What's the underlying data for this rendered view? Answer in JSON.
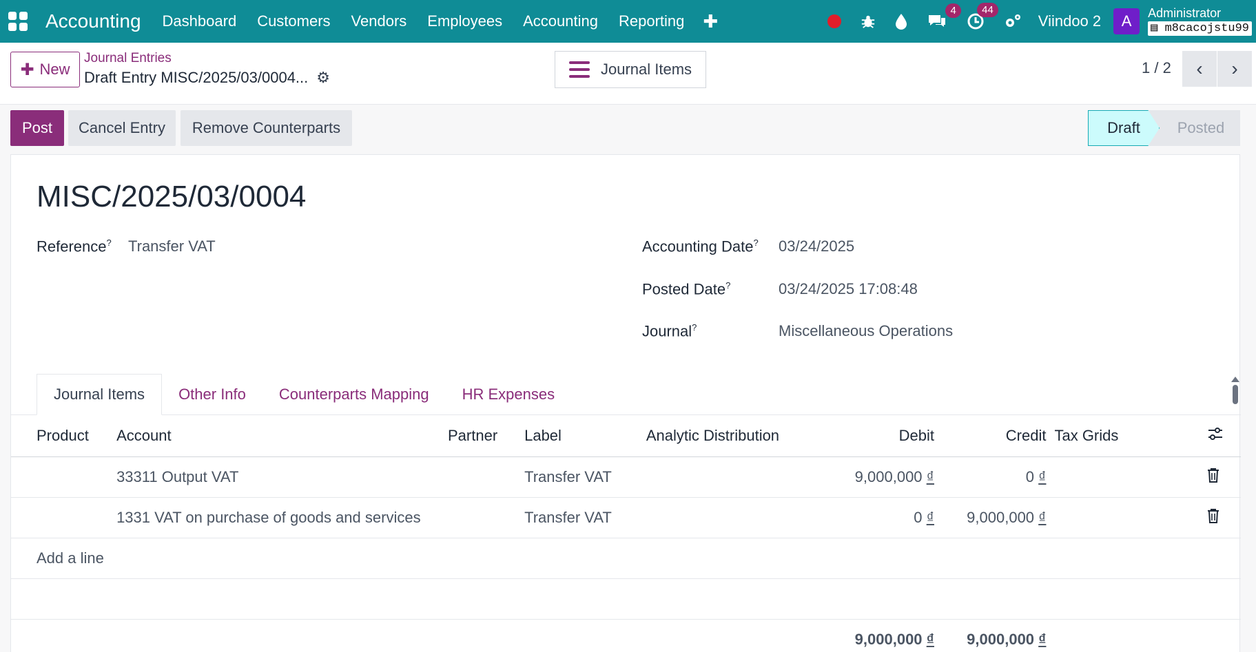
{
  "navbar": {
    "brand": "Accounting",
    "menu": [
      "Dashboard",
      "Customers",
      "Vendors",
      "Employees",
      "Accounting",
      "Reporting"
    ],
    "messages_count": "4",
    "activities_count": "44",
    "company": "Viindoo 2",
    "avatar_letter": "A",
    "user_name": "Administrator",
    "db_name": "m8cacojstu99"
  },
  "control": {
    "new_label": "New",
    "breadcrumb": "Journal Entries",
    "record_title": "Draft Entry MISC/2025/03/0004...",
    "smart_button": "Journal Items",
    "pager": "1 / 2"
  },
  "actions": {
    "post": "Post",
    "cancel": "Cancel Entry",
    "remove_counterparts": "Remove Counterparts"
  },
  "status": {
    "draft": "Draft",
    "posted": "Posted"
  },
  "form": {
    "name": "MISC/2025/03/0004",
    "reference_label": "Reference",
    "reference_value": "Transfer VAT",
    "accounting_date_label": "Accounting Date",
    "accounting_date_value": "03/24/2025",
    "posted_date_label": "Posted Date",
    "posted_date_value": "03/24/2025 17:08:48",
    "journal_label": "Journal",
    "journal_value": "Miscellaneous Operations",
    "help_mark": "?"
  },
  "tabs": [
    "Journal Items",
    "Other Info",
    "Counterparts Mapping",
    "HR Expenses"
  ],
  "lines": {
    "headers": {
      "product": "Product",
      "account": "Account",
      "partner": "Partner",
      "label": "Label",
      "analytic": "Analytic Distribution",
      "debit": "Debit",
      "credit": "Credit",
      "tax_grids": "Tax Grids"
    },
    "rows": [
      {
        "account": "33311 Output VAT",
        "label": "Transfer VAT",
        "debit": "9,000,000",
        "credit": "0"
      },
      {
        "account": "1331 VAT on purchase of goods and services",
        "label": "Transfer VAT",
        "debit": "0",
        "credit": "9,000,000"
      }
    ],
    "add_line": "Add a line",
    "currency": "₫",
    "total_debit": "9,000,000",
    "total_credit": "9,000,000"
  }
}
